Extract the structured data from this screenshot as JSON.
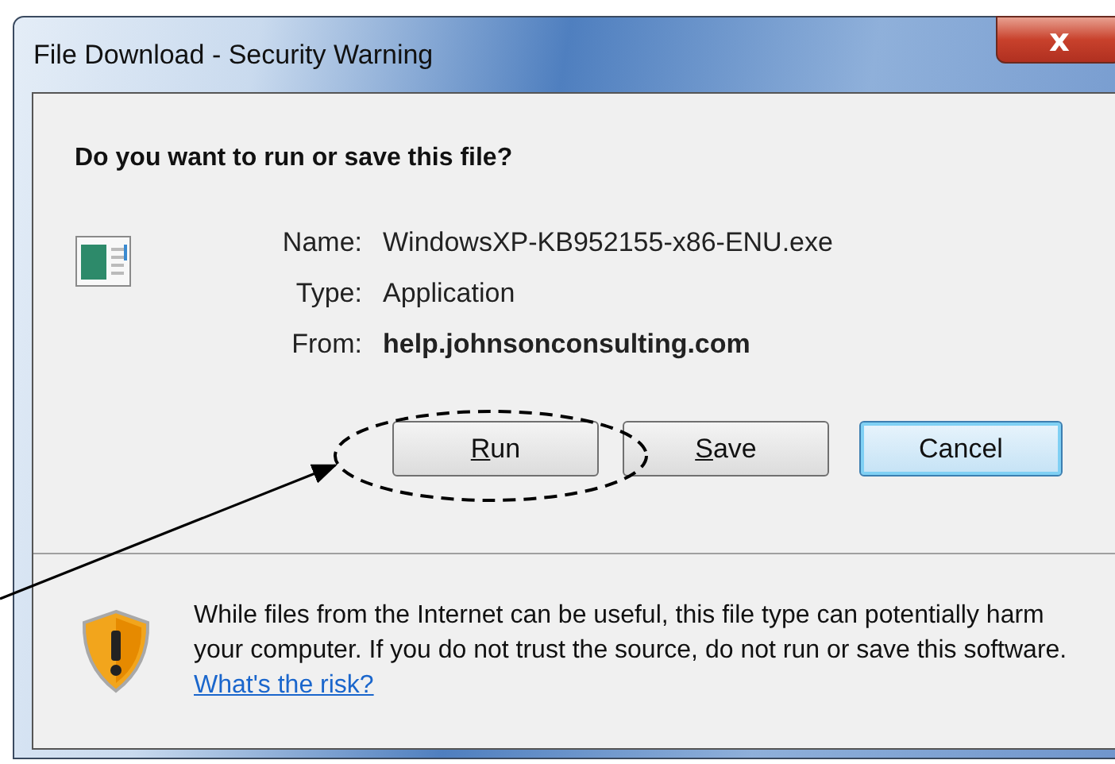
{
  "window": {
    "title": "File Download - Security Warning",
    "close": "x"
  },
  "question": "Do you want to run or save this file?",
  "fields": [
    {
      "label": "Name:",
      "value": "WindowsXP-KB952155-x86-ENU.exe",
      "bold": false
    },
    {
      "label": "Type:",
      "value": "Application",
      "bold": false
    },
    {
      "label": "From:",
      "value": "help.johnsonconsulting.com",
      "bold": true
    }
  ],
  "buttons": [
    {
      "key": "R",
      "label": "un",
      "default": false,
      "circled": true
    },
    {
      "key": "S",
      "label": "ave",
      "default": false,
      "circled": false
    },
    {
      "label": "Cancel",
      "default": true,
      "circled": false
    }
  ],
  "warning": {
    "text": "While files from the Internet can be useful, this file type can potentially harm your computer. If you do not trust the source, do not run or save this software.",
    "link": "What's the risk?"
  }
}
